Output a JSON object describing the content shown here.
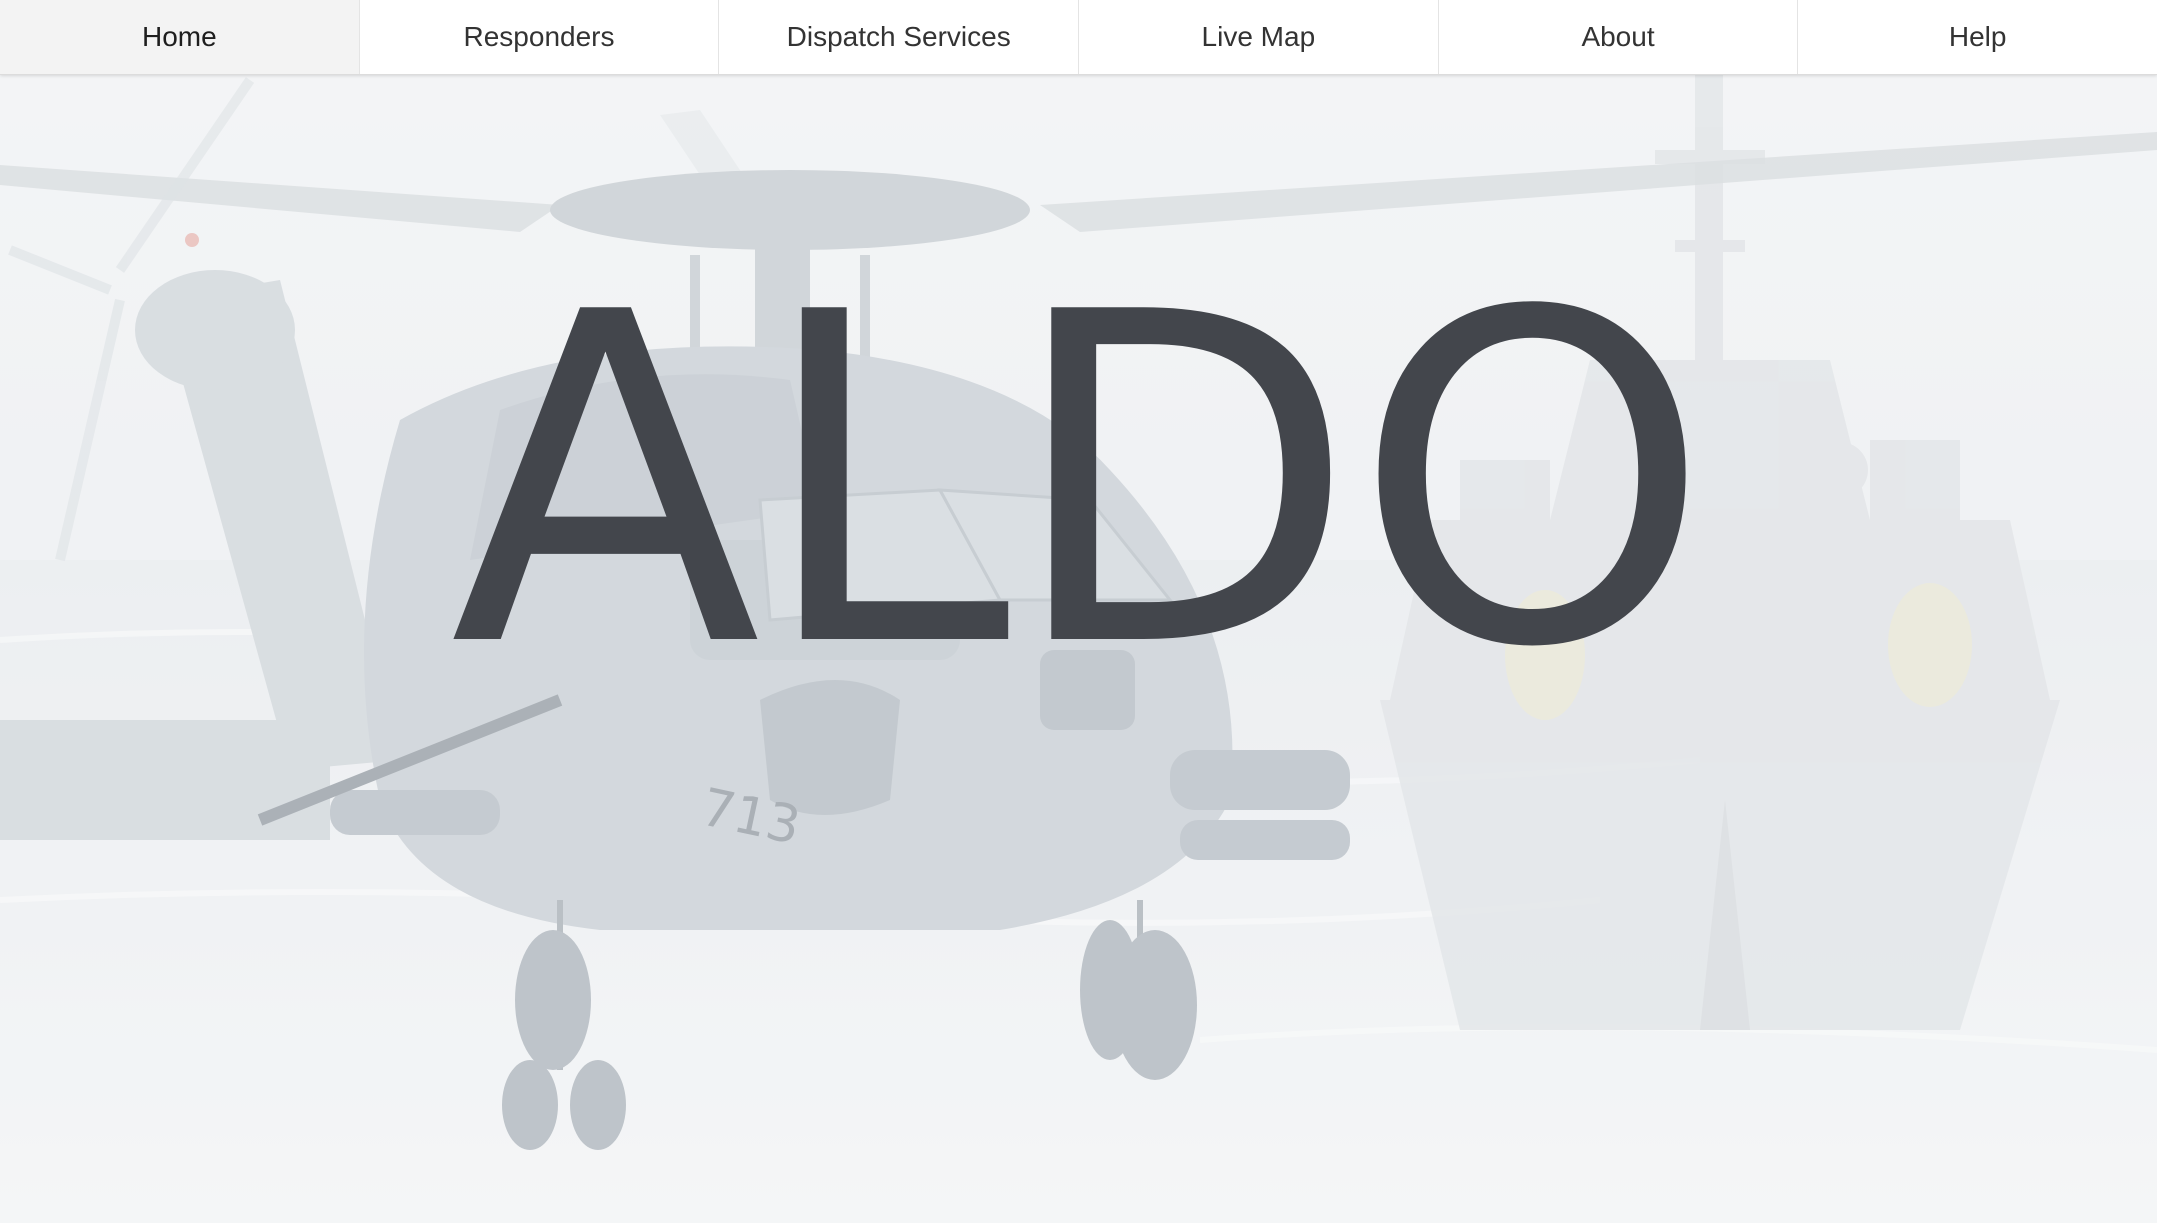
{
  "nav": {
    "items": [
      {
        "label": "Home",
        "active": true
      },
      {
        "label": "Responders",
        "active": false
      },
      {
        "label": "Dispatch Services",
        "active": false
      },
      {
        "label": "Live Map",
        "active": false
      },
      {
        "label": "About",
        "active": false
      },
      {
        "label": "Help",
        "active": false
      }
    ]
  },
  "hero": {
    "title": "ALDO",
    "background_image": "navy-helicopter-and-warship-photo",
    "aircraft_marking": "713"
  },
  "colors": {
    "title": "#43464c",
    "nav_background": "#ffffff",
    "nav_active_background": "#f3f3f3",
    "nav_text": "#333333"
  }
}
